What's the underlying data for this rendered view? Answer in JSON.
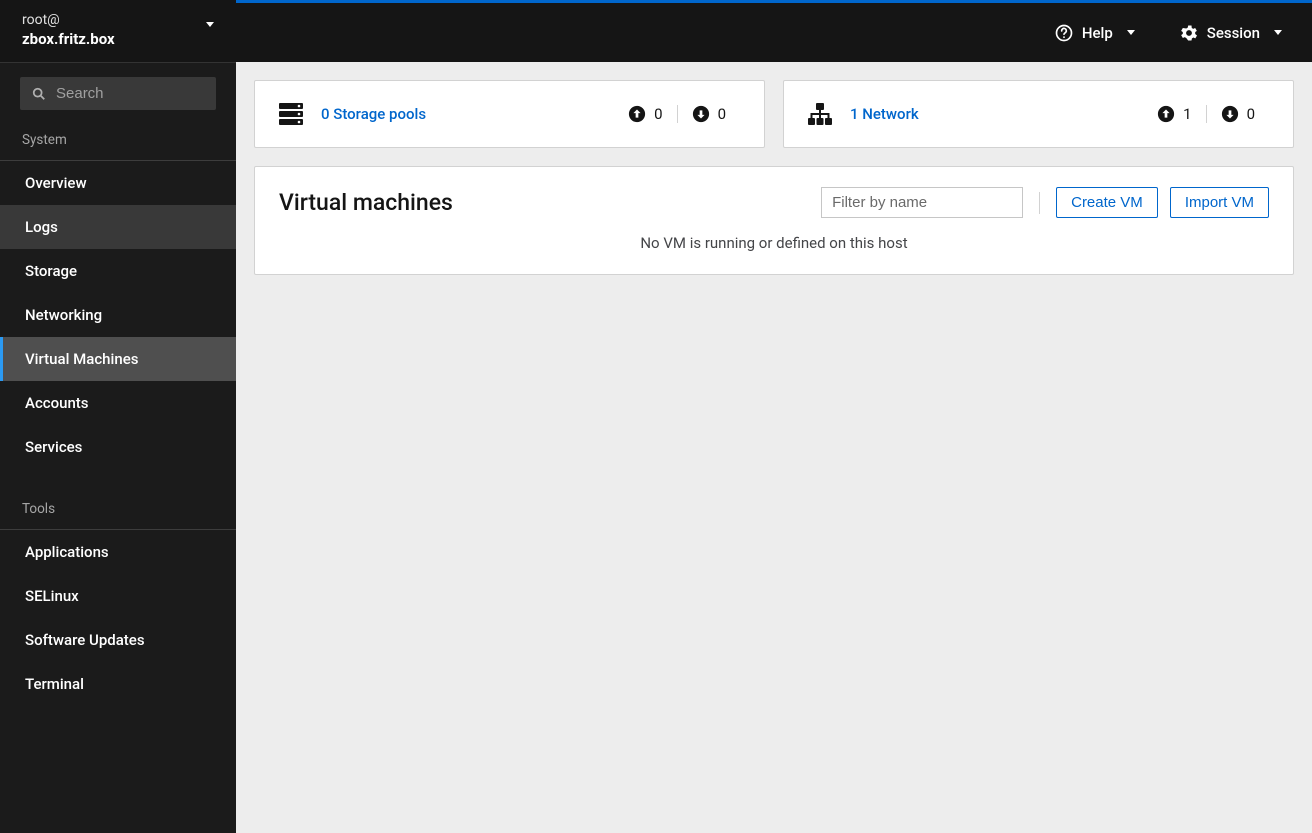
{
  "host": {
    "user": "root@",
    "name": "zbox.fritz.box"
  },
  "search": {
    "placeholder": "Search"
  },
  "sidebar": {
    "sections": [
      {
        "label": "System",
        "items": [
          {
            "label": "Overview"
          },
          {
            "label": "Logs"
          },
          {
            "label": "Storage"
          },
          {
            "label": "Networking"
          },
          {
            "label": "Virtual Machines"
          },
          {
            "label": "Accounts"
          },
          {
            "label": "Services"
          }
        ]
      },
      {
        "label": "Tools",
        "items": [
          {
            "label": "Applications"
          },
          {
            "label": "SELinux"
          },
          {
            "label": "Software Updates"
          },
          {
            "label": "Terminal"
          }
        ]
      }
    ]
  },
  "topbar": {
    "help": "Help",
    "session": "Session"
  },
  "cards": {
    "storage": {
      "link": "0 Storage pools",
      "up": "0",
      "down": "0"
    },
    "network": {
      "link": "1 Network",
      "up": "1",
      "down": "0"
    }
  },
  "vm_panel": {
    "title": "Virtual machines",
    "filter_placeholder": "Filter by name",
    "create": "Create VM",
    "import": "Import VM",
    "empty_msg": "No VM is running or defined on this host"
  }
}
